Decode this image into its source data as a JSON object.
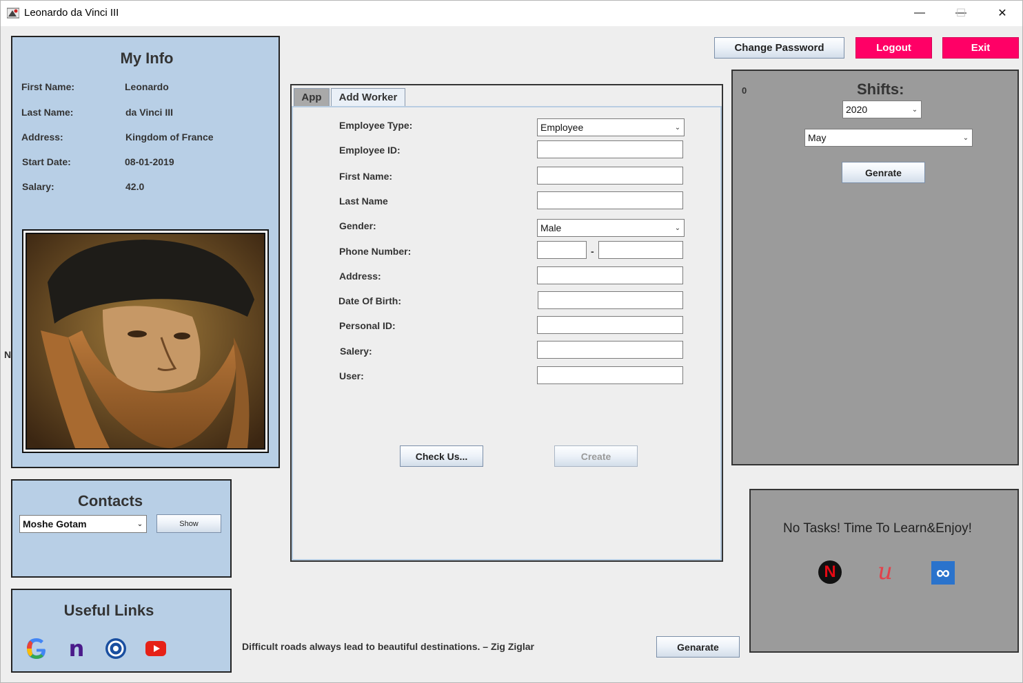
{
  "window": {
    "title": "Leonardo da Vinci III",
    "controls": {
      "minimize": "—",
      "maximize": "☐",
      "close": "✕"
    }
  },
  "my_info": {
    "heading": "My Info",
    "fields": [
      {
        "label": "First Name:",
        "value": "Leonardo"
      },
      {
        "label": "Last Name:",
        "value": "da Vinci III"
      },
      {
        "label": "Address:",
        "value": "Kingdom of France"
      },
      {
        "label": "Start Date:",
        "value": "08-01-2019"
      },
      {
        "label": "Salary:",
        "value": "42.0"
      }
    ]
  },
  "side_letter": "N",
  "contacts": {
    "heading": "Contacts",
    "selected": "Moshe Gotam",
    "show_label": "Show"
  },
  "useful_links": {
    "heading": "Useful Links",
    "icons": [
      "google-icon",
      "nu-icon",
      "ubisoft-icon",
      "youtube-icon"
    ],
    "google_letter": "G",
    "nu_letter": "n"
  },
  "top_buttons": {
    "change_password": "Change Password",
    "logout": "Logout",
    "exit": "Exit"
  },
  "tabs": [
    {
      "label": "App",
      "active": false
    },
    {
      "label": "Add Worker",
      "active": true
    }
  ],
  "form": {
    "employee_type": {
      "label": "Employee Type:",
      "value": "Employee"
    },
    "employee_id": {
      "label": "Employee ID:",
      "value": ""
    },
    "first_name": {
      "label": "First Name:",
      "value": ""
    },
    "last_name": {
      "label": "Last Name",
      "value": ""
    },
    "gender": {
      "label": "Gender:",
      "value": "Male"
    },
    "phone": {
      "label": "Phone Number:",
      "separator": "-",
      "prefix": "",
      "number": ""
    },
    "address": {
      "label": "Address:",
      "value": ""
    },
    "dob": {
      "label": "Date Of Birth:",
      "value": ""
    },
    "personal_id": {
      "label": "Personal ID:",
      "value": ""
    },
    "salary": {
      "label": "Salery:",
      "value": ""
    },
    "user": {
      "label": "User:",
      "value": ""
    },
    "check_button": "Check Us...",
    "create_button": "Create"
  },
  "quote": {
    "text": "Difficult roads always lead to beautiful destinations. – Zig Ziglar",
    "button": "Genarate"
  },
  "shifts": {
    "counter": "0",
    "heading": "Shifts:",
    "year": "2020",
    "month": "May",
    "button": "Genrate"
  },
  "tasks": {
    "message": "No Tasks! Time To Learn&Enjoy!",
    "icons": [
      "netflix-icon",
      "udemy-icon",
      "coursera-icon"
    ],
    "netflix_letter": "N",
    "udemy_letter": "u",
    "coursera_symbol": "∞"
  },
  "colors": {
    "panel_blue": "#b8cfe6",
    "panel_gray": "#9b9b9b",
    "accent_pink": "#ff0066"
  }
}
